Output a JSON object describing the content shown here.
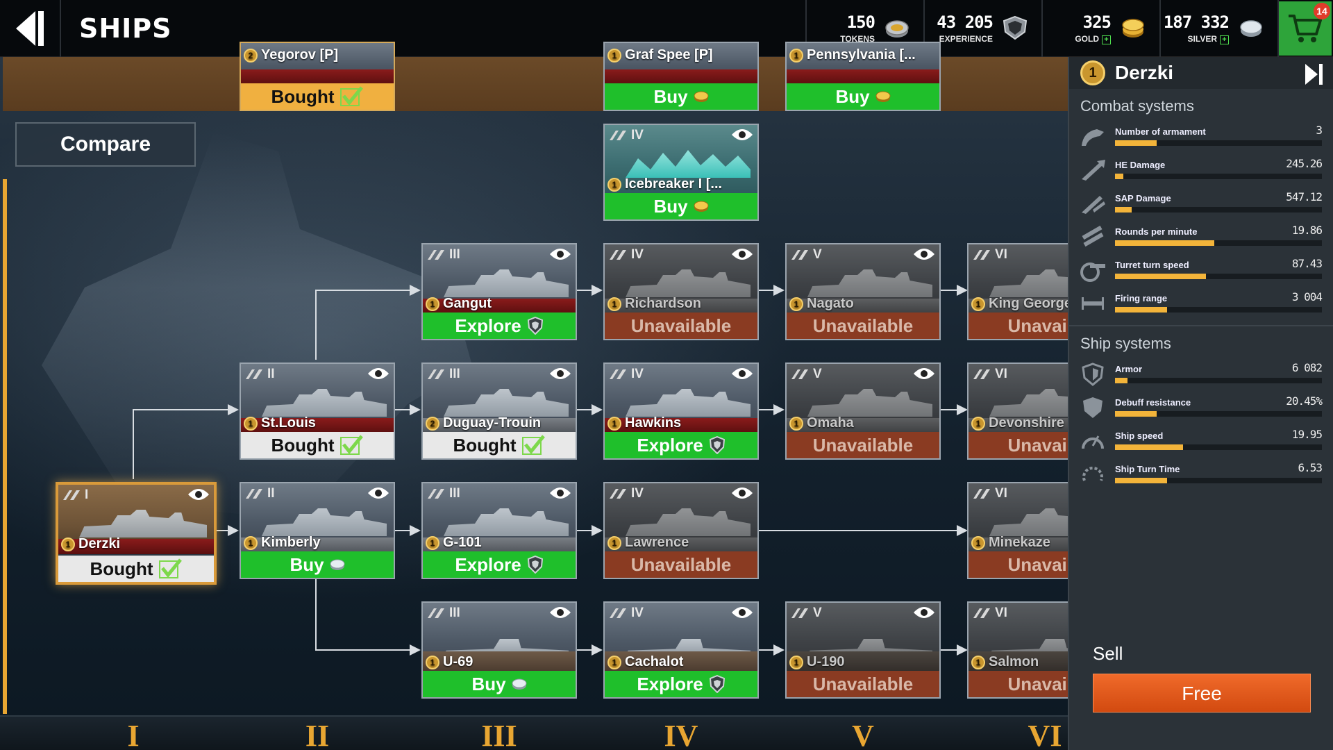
{
  "header": {
    "title": "SHIPS",
    "tokens": {
      "amount": "150",
      "label": "TOKENS"
    },
    "experience": {
      "amount": "43 205",
      "label": "EXPERIENCE"
    },
    "gold": {
      "amount": "325",
      "label": "GOLD"
    },
    "silver": {
      "amount": "187 332",
      "label": "SILVER"
    },
    "cart_badge": "14"
  },
  "compare_label": "Compare",
  "cards": [
    {
      "id": "yegorov",
      "tier": "",
      "name": "Yegorov [P]",
      "rank": "2",
      "action": "Bought",
      "style": "bought-gold"
    },
    {
      "id": "grafspee",
      "tier": "",
      "name": "Graf Spee [P]",
      "rank": "1",
      "action": "Buy",
      "style": "buy"
    },
    {
      "id": "pennsylvania",
      "tier": "",
      "name": "Pennsylvania [...",
      "rank": "1",
      "action": "Buy",
      "style": "buy"
    },
    {
      "id": "icebreaker",
      "tier": "IV",
      "name": "Icebreaker I [...",
      "rank": "1",
      "action": "Buy",
      "style": "buy"
    },
    {
      "id": "gangut",
      "tier": "III",
      "name": "Gangut",
      "rank": "1",
      "action": "Explore",
      "style": "explore"
    },
    {
      "id": "richardson",
      "tier": "IV",
      "name": "Richardson",
      "rank": "1",
      "action": "Unavailable",
      "style": "unavailable"
    },
    {
      "id": "nagato",
      "tier": "V",
      "name": "Nagato",
      "rank": "1",
      "action": "Unavailable",
      "style": "unavailable"
    },
    {
      "id": "kinggeorge",
      "tier": "VI",
      "name": "King George",
      "rank": "1",
      "action": "Unavaila",
      "style": "unavailable"
    },
    {
      "id": "stlouis",
      "tier": "II",
      "name": "St.Louis",
      "rank": "1",
      "action": "Bought",
      "style": "bought"
    },
    {
      "id": "duguay",
      "tier": "III",
      "name": "Duguay-Trouin",
      "rank": "2",
      "action": "Bought",
      "style": "bought"
    },
    {
      "id": "hawkins",
      "tier": "IV",
      "name": "Hawkins",
      "rank": "1",
      "action": "Explore",
      "style": "explore"
    },
    {
      "id": "omaha",
      "tier": "V",
      "name": "Omaha",
      "rank": "1",
      "action": "Unavailable",
      "style": "unavailable"
    },
    {
      "id": "devonshire",
      "tier": "VI",
      "name": "Devonshire",
      "rank": "1",
      "action": "Unavaila",
      "style": "unavailable"
    },
    {
      "id": "derzki",
      "tier": "I",
      "name": "Derzki",
      "rank": "1",
      "action": "Bought",
      "style": "bought"
    },
    {
      "id": "kimberly",
      "tier": "II",
      "name": "Kimberly",
      "rank": "1",
      "action": "Buy",
      "style": "buy"
    },
    {
      "id": "g101",
      "tier": "III",
      "name": "G-101",
      "rank": "1",
      "action": "Explore",
      "style": "explore"
    },
    {
      "id": "lawrence",
      "tier": "IV",
      "name": "Lawrence",
      "rank": "1",
      "action": "Unavailable",
      "style": "unavailable"
    },
    {
      "id": "minekaze",
      "tier": "VI",
      "name": "Minekaze",
      "rank": "1",
      "action": "Unavaila",
      "style": "unavailable"
    },
    {
      "id": "u69",
      "tier": "III",
      "name": "U-69",
      "rank": "1",
      "action": "Buy",
      "style": "buy"
    },
    {
      "id": "cachalot",
      "tier": "IV",
      "name": "Cachalot",
      "rank": "1",
      "action": "Explore",
      "style": "explore"
    },
    {
      "id": "u190",
      "tier": "V",
      "name": "U-190",
      "rank": "1",
      "action": "Unavailable",
      "style": "unavailable"
    },
    {
      "id": "salmon",
      "tier": "VI",
      "name": "Salmon",
      "rank": "1",
      "action": "Unavaila",
      "style": "unavailable"
    }
  ],
  "tier_labels": [
    "I",
    "II",
    "III",
    "IV",
    "V",
    "VI"
  ],
  "panel": {
    "rank": "1",
    "ship_name": "Derzki",
    "combat_title": "Combat systems",
    "combat": [
      {
        "label": "Number of armament",
        "value": "3",
        "fill": 0.2,
        "icon": "armament-icon"
      },
      {
        "label": "HE Damage",
        "value": "245.26",
        "fill": 0.04,
        "icon": "he-damage-icon"
      },
      {
        "label": "SAP Damage",
        "value": "547.12",
        "fill": 0.08,
        "icon": "sap-damage-icon"
      },
      {
        "label": "Rounds per minute",
        "value": "19.86",
        "fill": 0.48,
        "icon": "rounds-icon"
      },
      {
        "label": "Turret turn speed",
        "value": "87.43",
        "fill": 0.44,
        "icon": "turret-icon"
      },
      {
        "label": "Firing range",
        "value": "3 004",
        "fill": 0.25,
        "icon": "range-icon"
      }
    ],
    "ship_title": "Ship systems",
    "ship": [
      {
        "label": "Armor",
        "value": "6 082",
        "fill": 0.06,
        "icon": "armor-icon"
      },
      {
        "label": "Debuff resistance",
        "value": "20.45%",
        "fill": 0.2,
        "icon": "debuff-icon"
      },
      {
        "label": "Ship speed",
        "value": "19.95",
        "fill": 0.33,
        "icon": "speed-icon"
      },
      {
        "label": "Ship Turn Time",
        "value": "6.53",
        "fill": 0.25,
        "icon": "turn-time-icon"
      }
    ],
    "sell_label": "Sell",
    "free_label": "Free"
  }
}
